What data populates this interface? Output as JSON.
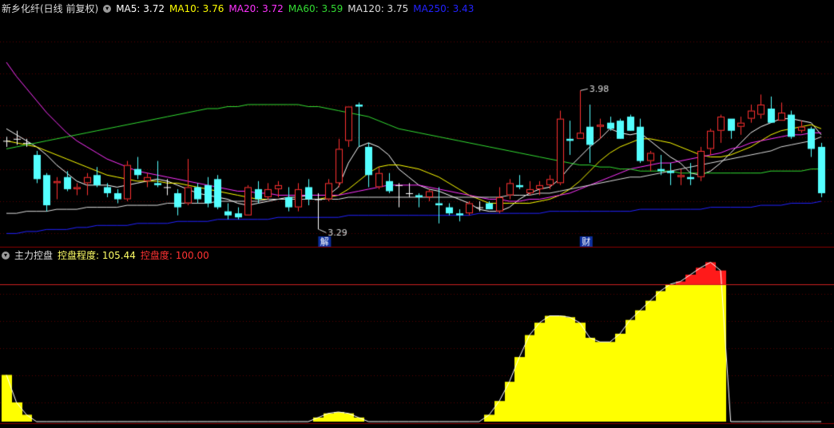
{
  "header": {
    "stock_title": "新乡化纤(日线 前复权)",
    "ma_labels": [
      {
        "text": "MA5: 3.72",
        "color": "#ffffff"
      },
      {
        "text": "MA10: 3.76",
        "color": "#ffff00"
      },
      {
        "text": "MA20: 3.72",
        "color": "#ff33ff"
      },
      {
        "text": "MA60: 3.59",
        "color": "#33dd33"
      },
      {
        "text": "MA120: 3.75",
        "color": "#dddddd"
      },
      {
        "text": "MA250: 3.43",
        "color": "#2222ff"
      }
    ]
  },
  "sub_header": {
    "indicator_name": "主力控盘",
    "label1": "控盘程度: 105.44",
    "label1_color": "#ffff66",
    "label2": "控盘度: 100.00",
    "label2_color": "#ff3333"
  },
  "chart_data": [
    {
      "type": "candlestick",
      "title": "新乡化纤(日线 前复权)",
      "annotations": [
        {
          "text": "3.98",
          "kind": "high_marker"
        },
        {
          "text": "3.29",
          "kind": "low_marker"
        },
        {
          "text": "解",
          "kind": "event_badge"
        },
        {
          "text": "财",
          "kind": "event_badge"
        }
      ],
      "colors": {
        "up": "#ff3030",
        "down": "#54ffff",
        "doji": "#ffffff"
      },
      "candles": [
        [
          3.73,
          3.75,
          3.7,
          3.73
        ],
        [
          3.74,
          3.78,
          3.71,
          3.74
        ],
        [
          3.72,
          3.74,
          3.7,
          3.72
        ],
        [
          3.66,
          3.68,
          3.52,
          3.54
        ],
        [
          3.56,
          3.57,
          3.38,
          3.41
        ],
        [
          3.52,
          3.55,
          3.44,
          3.53
        ],
        [
          3.55,
          3.58,
          3.48,
          3.49
        ],
        [
          3.49,
          3.52,
          3.46,
          3.5
        ],
        [
          3.52,
          3.57,
          3.46,
          3.55
        ],
        [
          3.56,
          3.6,
          3.5,
          3.51
        ],
        [
          3.5,
          3.52,
          3.45,
          3.47
        ],
        [
          3.47,
          3.49,
          3.42,
          3.44
        ],
        [
          3.44,
          3.63,
          3.43,
          3.61
        ],
        [
          3.59,
          3.65,
          3.54,
          3.56
        ],
        [
          3.53,
          3.57,
          3.5,
          3.55
        ],
        [
          3.52,
          3.63,
          3.5,
          3.51
        ],
        [
          3.5,
          3.54,
          3.46,
          3.5
        ],
        [
          3.47,
          3.49,
          3.36,
          3.4
        ],
        [
          3.42,
          3.64,
          3.41,
          3.5
        ],
        [
          3.5,
          3.52,
          3.42,
          3.44
        ],
        [
          3.51,
          3.55,
          3.4,
          3.42
        ],
        [
          3.54,
          3.56,
          3.39,
          3.4
        ],
        [
          3.38,
          3.42,
          3.34,
          3.36
        ],
        [
          3.37,
          3.4,
          3.34,
          3.35
        ],
        [
          3.36,
          3.51,
          3.36,
          3.5
        ],
        [
          3.49,
          3.53,
          3.42,
          3.44
        ],
        [
          3.45,
          3.52,
          3.44,
          3.49
        ],
        [
          3.49,
          3.53,
          3.45,
          3.51
        ],
        [
          3.45,
          3.5,
          3.38,
          3.4
        ],
        [
          3.4,
          3.52,
          3.38,
          3.49
        ],
        [
          3.5,
          3.54,
          3.41,
          3.44
        ],
        [
          3.44,
          3.47,
          3.29,
          3.44
        ],
        [
          3.44,
          3.54,
          3.43,
          3.52
        ],
        [
          3.52,
          3.74,
          3.5,
          3.69
        ],
        [
          3.73,
          3.79,
          3.7,
          3.9
        ],
        [
          3.91,
          3.92,
          3.7,
          3.9
        ],
        [
          3.7,
          3.72,
          3.5,
          3.56
        ],
        [
          3.5,
          3.6,
          3.49,
          3.57
        ],
        [
          3.53,
          3.57,
          3.47,
          3.48
        ],
        [
          3.51,
          3.52,
          3.4,
          3.51
        ],
        [
          3.47,
          3.52,
          3.45,
          3.47
        ],
        [
          3.46,
          3.47,
          3.4,
          3.45
        ],
        [
          3.45,
          3.49,
          3.43,
          3.48
        ],
        [
          3.42,
          3.5,
          3.32,
          3.41
        ],
        [
          3.4,
          3.42,
          3.36,
          3.37
        ],
        [
          3.37,
          3.39,
          3.33,
          3.36
        ],
        [
          3.37,
          3.43,
          3.36,
          3.42
        ],
        [
          3.4,
          3.43,
          3.38,
          3.4
        ],
        [
          3.42,
          3.43,
          3.39,
          3.39
        ],
        [
          3.38,
          3.5,
          3.37,
          3.45
        ],
        [
          3.46,
          3.54,
          3.44,
          3.52
        ],
        [
          3.51,
          3.56,
          3.49,
          3.5
        ],
        [
          3.47,
          3.53,
          3.46,
          3.49
        ],
        [
          3.49,
          3.53,
          3.46,
          3.51
        ],
        [
          3.51,
          3.56,
          3.49,
          3.54
        ],
        [
          3.52,
          3.88,
          3.51,
          3.84
        ],
        [
          3.74,
          3.83,
          3.66,
          3.73
        ],
        [
          3.74,
          3.98,
          3.74,
          3.77
        ],
        [
          3.8,
          3.91,
          3.62,
          3.71
        ],
        [
          3.8,
          3.84,
          3.74,
          3.81
        ],
        [
          3.82,
          3.85,
          3.78,
          3.79
        ],
        [
          3.83,
          3.84,
          3.74,
          3.74
        ],
        [
          3.85,
          3.86,
          3.78,
          3.78
        ],
        [
          3.8,
          3.84,
          3.62,
          3.63
        ],
        [
          3.63,
          3.68,
          3.58,
          3.67
        ],
        [
          3.59,
          3.66,
          3.56,
          3.58
        ],
        [
          3.58,
          3.62,
          3.51,
          3.57
        ],
        [
          3.55,
          3.59,
          3.51,
          3.56
        ],
        [
          3.55,
          3.62,
          3.51,
          3.54
        ],
        [
          3.55,
          3.7,
          3.53,
          3.68
        ],
        [
          3.69,
          3.79,
          3.66,
          3.78
        ],
        [
          3.78,
          3.86,
          3.72,
          3.85
        ],
        [
          3.84,
          3.83,
          3.74,
          3.78
        ],
        [
          3.8,
          3.85,
          3.76,
          3.82
        ],
        [
          3.84,
          3.91,
          3.82,
          3.88
        ],
        [
          3.86,
          3.96,
          3.84,
          3.91
        ],
        [
          3.89,
          3.95,
          3.82,
          3.82
        ],
        [
          3.83,
          3.92,
          3.84,
          3.87
        ],
        [
          3.86,
          3.88,
          3.74,
          3.75
        ],
        [
          3.78,
          3.83,
          3.77,
          3.8
        ],
        [
          3.79,
          3.8,
          3.65,
          3.69
        ],
        [
          3.7,
          3.72,
          3.45,
          3.47
        ]
      ],
      "moving_averages": [
        {
          "name": "MA5",
          "color": "#ffffff",
          "values": [
            3.79,
            3.76,
            3.73,
            3.7,
            3.66,
            3.61,
            3.57,
            3.53,
            3.51,
            3.51,
            3.51,
            3.5,
            3.51,
            3.52,
            3.53,
            3.54,
            3.53,
            3.51,
            3.49,
            3.47,
            3.46,
            3.45,
            3.44,
            3.42,
            3.41,
            3.42,
            3.43,
            3.44,
            3.45,
            3.45,
            3.46,
            3.46,
            3.46,
            3.5,
            3.62,
            3.7,
            3.72,
            3.7,
            3.66,
            3.59,
            3.55,
            3.51,
            3.49,
            3.48,
            3.46,
            3.44,
            3.42,
            3.39,
            3.38,
            3.38,
            3.4,
            3.44,
            3.47,
            3.49,
            3.5,
            3.54,
            3.6,
            3.65,
            3.7,
            3.74,
            3.79,
            3.77,
            3.76,
            3.77,
            3.73,
            3.69,
            3.65,
            3.62,
            3.57,
            3.56,
            3.58,
            3.62,
            3.67,
            3.72,
            3.77,
            3.8,
            3.82,
            3.84,
            3.84,
            3.83,
            3.82,
            3.76
          ]
        },
        {
          "name": "MA10",
          "color": "#ffff00",
          "values": [
            3.73,
            3.72,
            3.71,
            3.7,
            3.68,
            3.66,
            3.64,
            3.62,
            3.6,
            3.58,
            3.56,
            3.55,
            3.54,
            3.53,
            3.53,
            3.53,
            3.52,
            3.52,
            3.51,
            3.5,
            3.49,
            3.48,
            3.47,
            3.46,
            3.45,
            3.44,
            3.44,
            3.44,
            3.44,
            3.44,
            3.44,
            3.44,
            3.45,
            3.46,
            3.49,
            3.53,
            3.57,
            3.6,
            3.61,
            3.61,
            3.6,
            3.59,
            3.57,
            3.55,
            3.52,
            3.49,
            3.46,
            3.44,
            3.42,
            3.42,
            3.42,
            3.42,
            3.42,
            3.43,
            3.44,
            3.46,
            3.49,
            3.53,
            3.58,
            3.63,
            3.67,
            3.7,
            3.72,
            3.74,
            3.74,
            3.73,
            3.72,
            3.7,
            3.68,
            3.66,
            3.65,
            3.65,
            3.66,
            3.68,
            3.7,
            3.73,
            3.76,
            3.78,
            3.79,
            3.8,
            3.81,
            3.79
          ]
        },
        {
          "name": "MA20",
          "color": "#ff33ff",
          "values": [
            4.12,
            4.05,
            3.99,
            3.93,
            3.87,
            3.82,
            3.77,
            3.73,
            3.7,
            3.67,
            3.64,
            3.62,
            3.6,
            3.58,
            3.57,
            3.56,
            3.55,
            3.54,
            3.53,
            3.52,
            3.51,
            3.5,
            3.49,
            3.48,
            3.48,
            3.47,
            3.47,
            3.46,
            3.46,
            3.46,
            3.46,
            3.46,
            3.46,
            3.46,
            3.47,
            3.48,
            3.49,
            3.5,
            3.51,
            3.51,
            3.51,
            3.51,
            3.5,
            3.49,
            3.48,
            3.47,
            3.46,
            3.45,
            3.44,
            3.44,
            3.43,
            3.43,
            3.44,
            3.44,
            3.45,
            3.46,
            3.47,
            3.49,
            3.51,
            3.53,
            3.55,
            3.57,
            3.59,
            3.6,
            3.61,
            3.62,
            3.62,
            3.63,
            3.64,
            3.65,
            3.66,
            3.67,
            3.69,
            3.7,
            3.72,
            3.73,
            3.74,
            3.75,
            3.76,
            3.76,
            3.77,
            3.77
          ]
        },
        {
          "name": "MA60",
          "color": "#33dd33",
          "values": [
            3.69,
            3.7,
            3.71,
            3.72,
            3.73,
            3.74,
            3.75,
            3.76,
            3.77,
            3.78,
            3.79,
            3.8,
            3.81,
            3.82,
            3.83,
            3.84,
            3.85,
            3.86,
            3.87,
            3.88,
            3.89,
            3.89,
            3.9,
            3.9,
            3.91,
            3.91,
            3.91,
            3.91,
            3.91,
            3.91,
            3.9,
            3.9,
            3.89,
            3.88,
            3.87,
            3.86,
            3.85,
            3.83,
            3.81,
            3.79,
            3.78,
            3.77,
            3.76,
            3.75,
            3.74,
            3.73,
            3.72,
            3.71,
            3.7,
            3.69,
            3.68,
            3.67,
            3.66,
            3.65,
            3.64,
            3.63,
            3.62,
            3.61,
            3.61,
            3.6,
            3.6,
            3.59,
            3.59,
            3.58,
            3.58,
            3.58,
            3.58,
            3.57,
            3.57,
            3.57,
            3.57,
            3.57,
            3.57,
            3.57,
            3.57,
            3.57,
            3.58,
            3.58,
            3.58,
            3.58,
            3.59,
            3.59
          ]
        },
        {
          "name": "MA120",
          "color": "#dddddd",
          "values": [
            3.37,
            3.37,
            3.38,
            3.38,
            3.38,
            3.39,
            3.39,
            3.39,
            3.4,
            3.4,
            3.4,
            3.4,
            3.41,
            3.41,
            3.41,
            3.41,
            3.42,
            3.42,
            3.42,
            3.42,
            3.42,
            3.43,
            3.43,
            3.43,
            3.43,
            3.43,
            3.44,
            3.44,
            3.44,
            3.44,
            3.44,
            3.44,
            3.44,
            3.44,
            3.45,
            3.45,
            3.45,
            3.45,
            3.45,
            3.45,
            3.45,
            3.45,
            3.45,
            3.45,
            3.45,
            3.45,
            3.45,
            3.45,
            3.45,
            3.45,
            3.46,
            3.46,
            3.46,
            3.47,
            3.47,
            3.48,
            3.49,
            3.5,
            3.51,
            3.52,
            3.53,
            3.54,
            3.55,
            3.55,
            3.56,
            3.57,
            3.58,
            3.59,
            3.6,
            3.61,
            3.62,
            3.63,
            3.64,
            3.65,
            3.66,
            3.67,
            3.68,
            3.7,
            3.71,
            3.72,
            3.73,
            3.75
          ]
        },
        {
          "name": "MA250",
          "color": "#2222ff",
          "values": [
            3.27,
            3.27,
            3.28,
            3.28,
            3.29,
            3.29,
            3.29,
            3.3,
            3.3,
            3.31,
            3.31,
            3.31,
            3.31,
            3.32,
            3.32,
            3.32,
            3.32,
            3.33,
            3.33,
            3.33,
            3.33,
            3.34,
            3.34,
            3.34,
            3.34,
            3.34,
            3.34,
            3.35,
            3.35,
            3.35,
            3.35,
            3.35,
            3.35,
            3.35,
            3.36,
            3.36,
            3.36,
            3.36,
            3.36,
            3.36,
            3.36,
            3.36,
            3.36,
            3.36,
            3.36,
            3.36,
            3.36,
            3.37,
            3.37,
            3.37,
            3.37,
            3.37,
            3.37,
            3.37,
            3.38,
            3.38,
            3.38,
            3.38,
            3.38,
            3.38,
            3.38,
            3.38,
            3.38,
            3.39,
            3.39,
            3.39,
            3.39,
            3.39,
            3.39,
            3.39,
            3.4,
            3.4,
            3.4,
            3.4,
            3.4,
            3.41,
            3.41,
            3.41,
            3.42,
            3.42,
            3.42,
            3.43
          ]
        }
      ]
    },
    {
      "type": "bar",
      "title": "主力控盘",
      "ylim": [
        0,
        118
      ],
      "threshold_line": 100,
      "colors": {
        "base": "#ffff00",
        "excess": "#ff1a1a",
        "threshold": "#cc1f1f",
        "outline": "#ffffff"
      },
      "series": [
        {
          "name": "控盘程度",
          "values": [
            34,
            14,
            5,
            0,
            0,
            0,
            0,
            0,
            0,
            0,
            0,
            0,
            0,
            0,
            0,
            0,
            0,
            0,
            0,
            0,
            0,
            0,
            0,
            0,
            0,
            0,
            0,
            0,
            0,
            0,
            0,
            3,
            6,
            7,
            6,
            3,
            0,
            0,
            0,
            0,
            0,
            0,
            0,
            0,
            0,
            0,
            0,
            0,
            0,
            0,
            0,
            0,
            0,
            0,
            0,
            0,
            0,
            0,
            0,
            0,
            0,
            0,
            0,
            0,
            0,
            0,
            0,
            0,
            0,
            0,
            0,
            0,
            0,
            0,
            0,
            0,
            0,
            0,
            0,
            0,
            0,
            0
          ]
        }
      ]
    }
  ]
}
